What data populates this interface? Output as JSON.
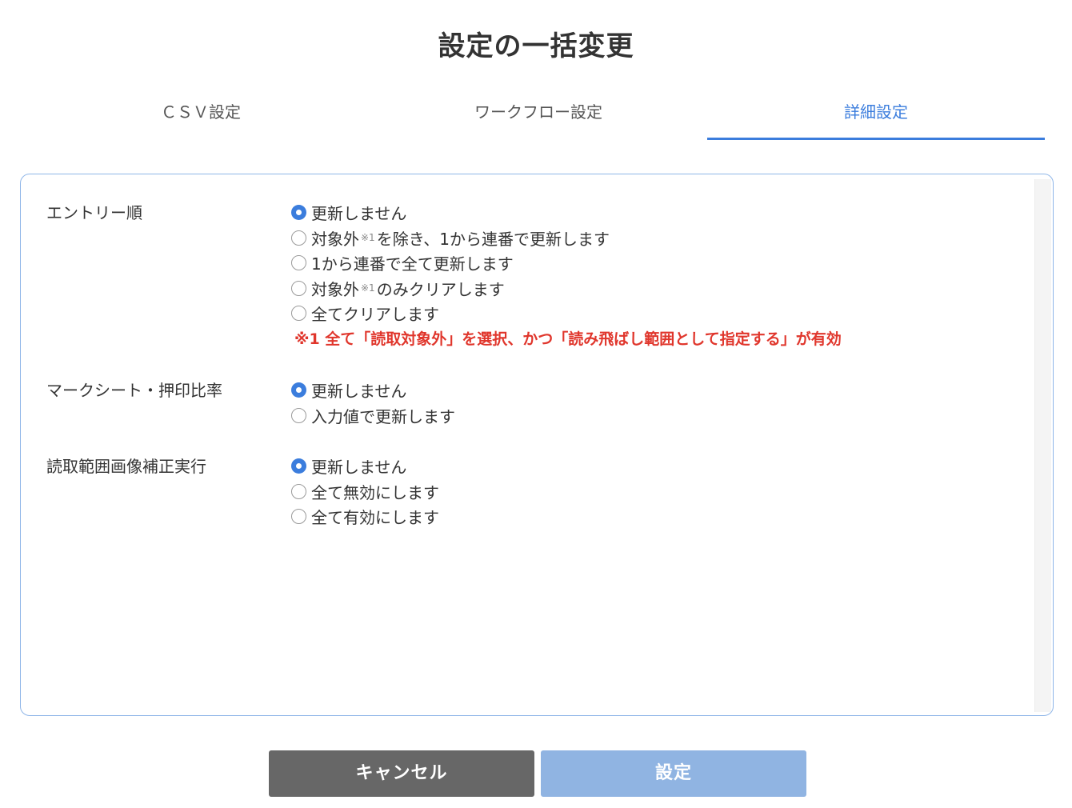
{
  "page": {
    "title": "設定の一括変更"
  },
  "tabs": [
    {
      "label": "ＣＳＶ設定",
      "active": false
    },
    {
      "label": "ワークフロー設定",
      "active": false
    },
    {
      "label": "詳細設定",
      "active": true
    }
  ],
  "groups": {
    "entry_order": {
      "label": "エントリー順",
      "options": [
        {
          "text": "更新しません",
          "checked": true
        },
        {
          "pre": "対象外",
          "sup": "※1",
          "post": "を除き、1から連番で更新します",
          "checked": false
        },
        {
          "text": "1から連番で全て更新します",
          "checked": false
        },
        {
          "pre": "対象外",
          "sup": "※1",
          "post": "のみクリアします",
          "checked": false
        },
        {
          "text": "全てクリアします",
          "checked": false
        }
      ],
      "note": "※1 全て「読取対象外」を選択、かつ「読み飛ばし範囲として指定する」が有効"
    },
    "mark_ratio": {
      "label": "マークシート・押印比率",
      "options": [
        {
          "text": "更新しません",
          "checked": true
        },
        {
          "text": "入力値で更新します",
          "checked": false
        }
      ]
    },
    "image_correction": {
      "label": "読取範囲画像補正実行",
      "options": [
        {
          "text": "更新しません",
          "checked": true
        },
        {
          "text": "全て無効にします",
          "checked": false
        },
        {
          "text": "全て有効にします",
          "checked": false
        }
      ]
    }
  },
  "buttons": {
    "cancel": "キャンセル",
    "submit": "設定"
  },
  "colors": {
    "accent": "#3b7ddd",
    "note": "#e0362c",
    "cancel_bg": "#676767",
    "submit_bg": "#90b4e2"
  }
}
